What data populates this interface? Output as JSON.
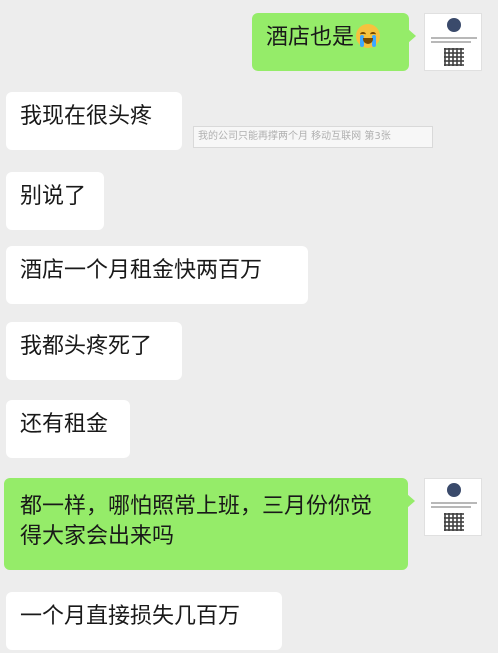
{
  "messages": [
    {
      "side": "out",
      "text": "酒店也是",
      "emoji": "loudly-crying-face"
    },
    {
      "side": "in",
      "text": "我现在很头疼"
    },
    {
      "side": "in",
      "text": "别说了"
    },
    {
      "side": "in",
      "text": "酒店一个月租金快两百万"
    },
    {
      "side": "in",
      "text": "我都头疼死了"
    },
    {
      "side": "in",
      "text": "还有租金"
    },
    {
      "side": "out",
      "text": "都一样，哪怕照常上班，三月份你觉得大家会出来吗"
    },
    {
      "side": "in",
      "text": "一个月直接损失几百万"
    }
  ],
  "watermark": "我的公司只能再撑两个月 移动互联网 第3张",
  "colors": {
    "background": "#ededed",
    "incoming": "#ffffff",
    "outgoing": "#95ec69"
  }
}
